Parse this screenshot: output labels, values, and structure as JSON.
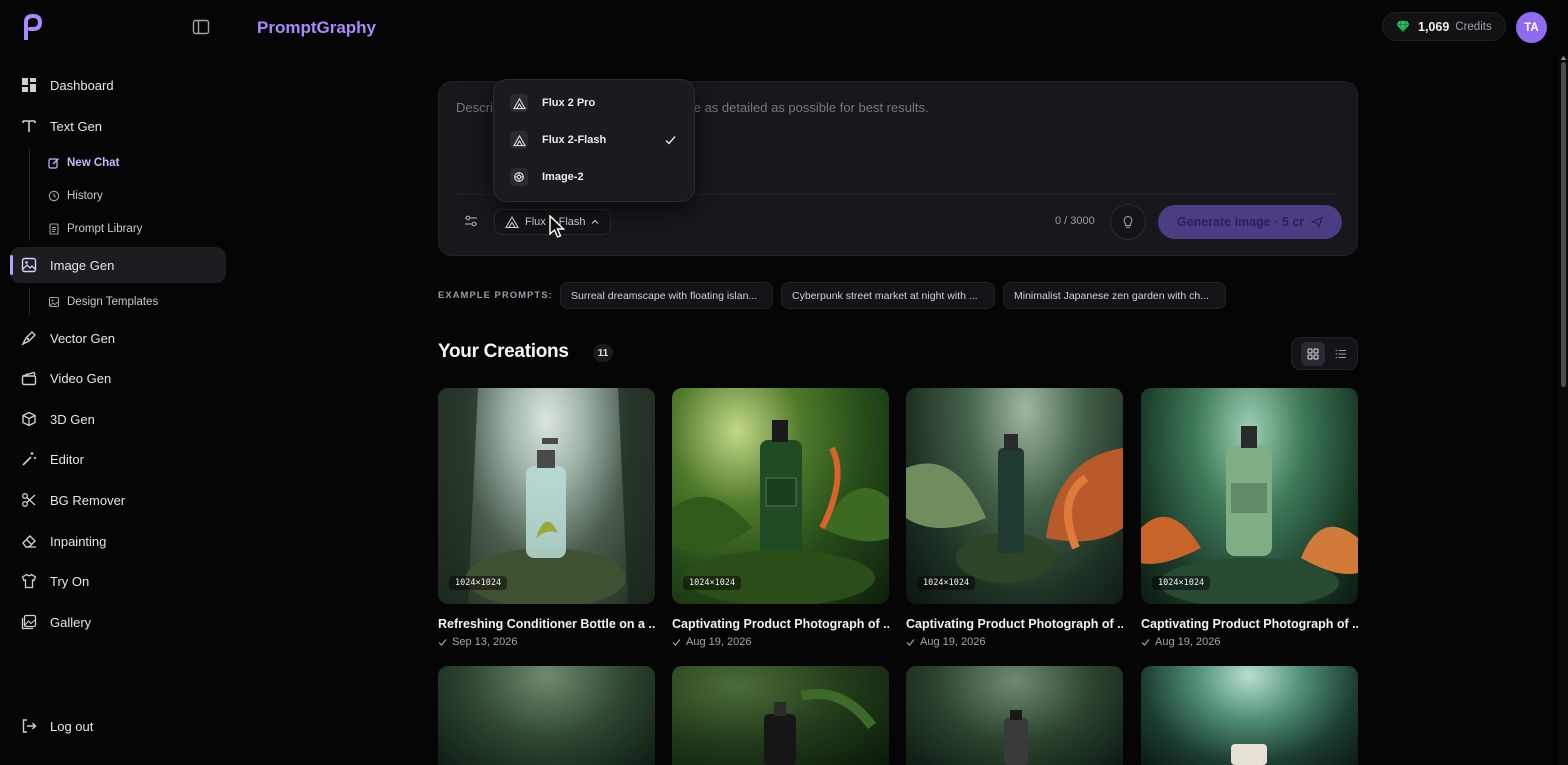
{
  "app": {
    "brand": "PromptGraphy"
  },
  "header": {
    "credits_value": "1,069",
    "credits_label": "Credits",
    "avatar_initials": "TA"
  },
  "sidebar": {
    "dashboard": "Dashboard",
    "text_gen": "Text Gen",
    "new_chat": "New Chat",
    "history": "History",
    "prompt_library": "Prompt Library",
    "image_gen": "Image Gen",
    "design_templates": "Design Templates",
    "vector_gen": "Vector Gen",
    "video_gen": "Video Gen",
    "gen_3d": "3D Gen",
    "editor": "Editor",
    "bg_remover": "BG Remover",
    "inpainting": "Inpainting",
    "try_on": "Try On",
    "gallery": "Gallery",
    "logout": "Log out"
  },
  "prompt": {
    "placeholder": "Describe the image you want to create. Be as detailed as possible for best results.",
    "model_selected": "Flux 2-Flash",
    "counter": "0 / 3000",
    "generate_label": "Generate Image · 5 cr"
  },
  "model_menu": {
    "items": [
      {
        "label": "Flux 2 Pro",
        "icon": "flux-icon",
        "selected": false
      },
      {
        "label": "Flux 2-Flash",
        "icon": "flux-icon",
        "selected": true
      },
      {
        "label": "Image-2",
        "icon": "openai-icon",
        "selected": false
      }
    ]
  },
  "examples": {
    "label": "EXAMPLE PROMPTS:",
    "chips": [
      "Surreal dreamscape with floating islan...",
      "Cyberpunk street market at night with ...",
      "Minimalist Japanese zen garden with ch..."
    ]
  },
  "creations": {
    "title": "Your Creations",
    "count": "11",
    "cards": [
      {
        "dims": "1024×1024",
        "title": "Refreshing Conditioner Bottle on a ...",
        "date": "Sep 13, 2026"
      },
      {
        "dims": "1024×1024",
        "title": "Captivating Product Photograph of ...",
        "date": "Aug 19, 2026"
      },
      {
        "dims": "1024×1024",
        "title": "Captivating Product Photograph of ...",
        "date": "Aug 19, 2026"
      },
      {
        "dims": "1024×1024",
        "title": "Captivating Product Photograph of ...",
        "date": "Aug 19, 2026"
      }
    ]
  },
  "colors": {
    "accent": "#a88bfa",
    "background": "#050505",
    "card": "#18181c",
    "button": "#4c3d82"
  }
}
